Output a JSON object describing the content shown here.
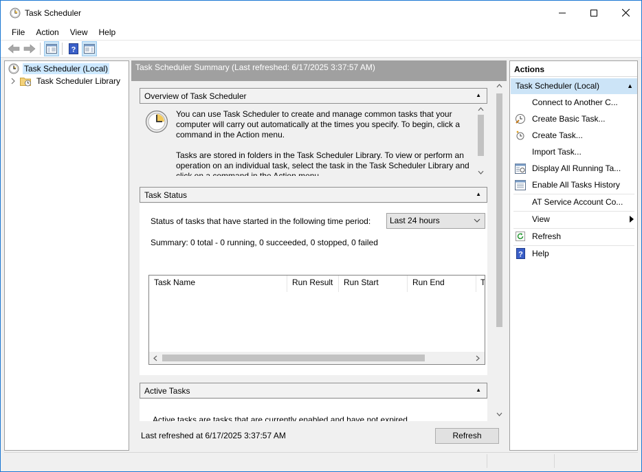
{
  "window": {
    "title": "Task Scheduler"
  },
  "menu": [
    "File",
    "Action",
    "View",
    "Help"
  ],
  "tree": {
    "items": [
      {
        "label": "Task Scheduler (Local)",
        "selected": true
      },
      {
        "label": "Task Scheduler Library",
        "selected": false
      }
    ]
  },
  "summary": {
    "header": "Task Scheduler Summary (Last refreshed: 6/17/2025 3:37:57 AM)",
    "overview": {
      "title": "Overview of Task Scheduler",
      "p1": "You can use Task Scheduler to create and manage common tasks that your computer will carry out automatically at the times you specify. To begin, click a command in the Action menu.",
      "p2": "Tasks are stored in folders in the Task Scheduler Library. To view or perform an operation on an individual task, select the task in the Task Scheduler Library and click on a command in the Action menu."
    },
    "task_status": {
      "title": "Task Status",
      "period_label": "Status of tasks that have started in the following time period:",
      "period_value": "Last 24 hours",
      "summary": "Summary: 0 total - 0 running, 0 succeeded, 0 stopped, 0 failed",
      "columns": [
        "Task Name",
        "Run Result",
        "Run Start",
        "Run End",
        "T"
      ]
    },
    "active_tasks": {
      "title": "Active Tasks",
      "text": "Active tasks are tasks that are currently enabled and have not expired."
    },
    "footer": {
      "last_refreshed": "Last refreshed at 6/17/2025 3:37:57 AM",
      "refresh_button": "Refresh"
    }
  },
  "actions": {
    "title": "Actions",
    "group": "Task Scheduler (Local)",
    "items": [
      {
        "label": "Connect to Another C...",
        "icon": "none"
      },
      {
        "label": "Create Basic Task...",
        "icon": "wizard-icon"
      },
      {
        "label": "Create Task...",
        "icon": "new-task-icon"
      },
      {
        "label": "Import Task...",
        "icon": "none"
      },
      {
        "label": "Display All Running Ta...",
        "icon": "running-tasks-icon"
      },
      {
        "label": "Enable All Tasks History",
        "icon": "history-icon"
      },
      {
        "label": "AT Service Account Co...",
        "icon": "none"
      },
      {
        "label": "View",
        "icon": "none"
      },
      {
        "label": "Refresh",
        "icon": "refresh-icon"
      },
      {
        "label": "Help",
        "icon": "help-icon"
      }
    ]
  },
  "colors": {
    "accent_selection": "#cce4f7",
    "header_gray": "#a0a0a0",
    "window_border": "#1976d2"
  }
}
